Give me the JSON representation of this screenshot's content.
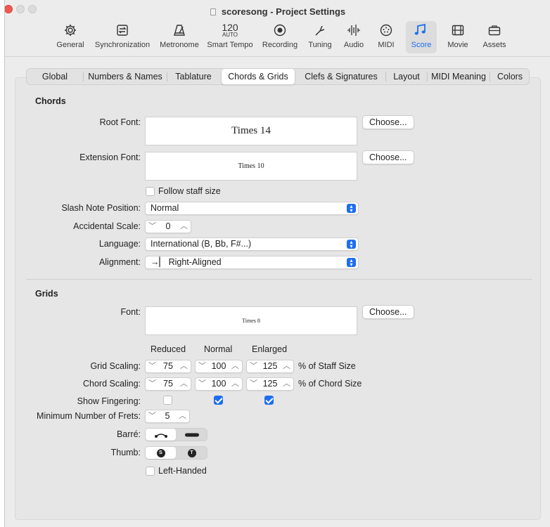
{
  "window": {
    "title": "scoresong - Project Settings"
  },
  "toolbar": [
    {
      "label": "General",
      "icon": "gear-icon"
    },
    {
      "label": "Synchronization",
      "icon": "sync-icon"
    },
    {
      "label": "Metronome",
      "icon": "metronome-icon"
    },
    {
      "label": "Smart Tempo",
      "icon": "tempo-icon",
      "top": "120",
      "sub": "AUTO"
    },
    {
      "label": "Recording",
      "icon": "record-icon"
    },
    {
      "label": "Tuning",
      "icon": "tuning-fork-icon"
    },
    {
      "label": "Audio",
      "icon": "waveform-icon"
    },
    {
      "label": "MIDI",
      "icon": "midi-icon"
    },
    {
      "label": "Score",
      "icon": "notes-icon",
      "selected": true
    },
    {
      "label": "Movie",
      "icon": "film-icon"
    },
    {
      "label": "Assets",
      "icon": "briefcase-icon"
    }
  ],
  "tabs": [
    "Global",
    "Numbers & Names",
    "Tablature",
    "Chords & Grids",
    "Clefs & Signatures",
    "Layout",
    "MIDI Meaning",
    "Colors"
  ],
  "selected_tab": "Chords & Grids",
  "chords": {
    "header": "Chords",
    "root_font_label": "Root Font:",
    "root_font_value": "Times 14",
    "extension_font_label": "Extension Font:",
    "extension_font_value": "Times 10",
    "choose_label": "Choose...",
    "follow_staff_label": "Follow staff size",
    "slash_label": "Slash Note Position:",
    "slash_value": "Normal",
    "accidental_label": "Accidental Scale:",
    "accidental_value": "0",
    "language_label": "Language:",
    "language_value": "International (B, Bb, F#...)",
    "alignment_label": "Alignment:",
    "alignment_value": "→▏ Right-Aligned"
  },
  "grids": {
    "header": "Grids",
    "font_label": "Font:",
    "font_value": "Times 8",
    "choose_label": "Choose...",
    "col_reduced": "Reduced",
    "col_normal": "Normal",
    "col_enlarged": "Enlarged",
    "grid_scaling_label": "Grid Scaling:",
    "grid_scaling": [
      "75",
      "100",
      "125"
    ],
    "grid_scaling_suffix": "% of Staff Size",
    "chord_scaling_label": "Chord Scaling:",
    "chord_scaling": [
      "75",
      "100",
      "125"
    ],
    "chord_scaling_suffix": "% of Chord Size",
    "show_fingering_label": "Show Fingering:",
    "show_fingering": [
      false,
      true,
      true
    ],
    "min_frets_label": "Minimum Number of Frets:",
    "min_frets_value": "5",
    "barre_label": "Barré:",
    "thumb_label": "Thumb:",
    "thumb_s": "S",
    "thumb_t": "T",
    "left_handed_label": "Left-Handed"
  },
  "colors": {
    "accent": "#1d6ef0",
    "close": "#ee5a52"
  }
}
